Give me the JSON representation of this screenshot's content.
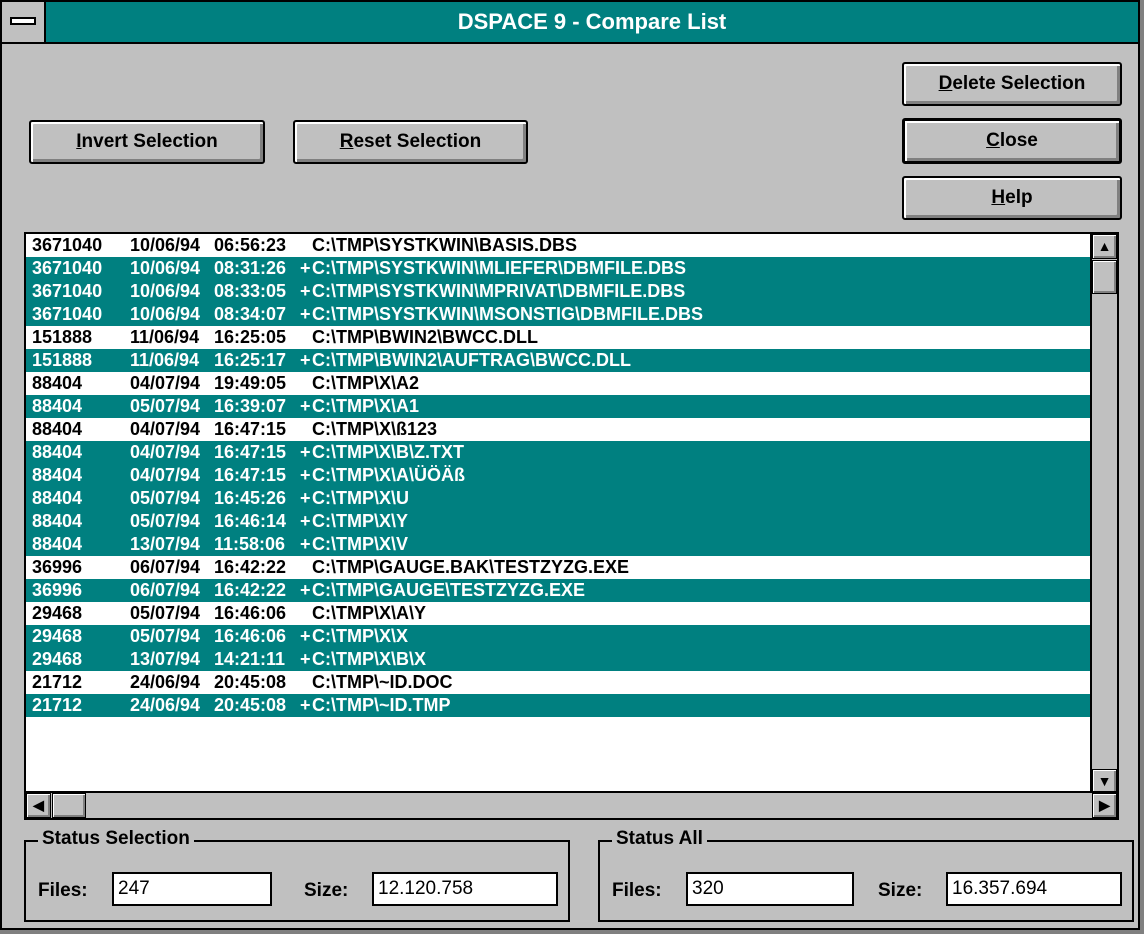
{
  "window": {
    "title": "DSPACE 9 - Compare List"
  },
  "buttons": {
    "delete_selection": {
      "pre": "",
      "key": "D",
      "post": "elete Selection"
    },
    "invert_selection": {
      "pre": "",
      "key": "I",
      "post": "nvert Selection"
    },
    "reset_selection": {
      "pre": "",
      "key": "R",
      "post": "eset Selection"
    },
    "close": {
      "pre": "",
      "key": "C",
      "post": "lose"
    },
    "help": {
      "pre": "",
      "key": "H",
      "post": "elp"
    }
  },
  "list": {
    "rows": [
      {
        "size": "3671040",
        "date": "10/06/94",
        "time": "06:56:23",
        "flag": "",
        "path": "C:\\TMP\\SYSTKWIN\\BASIS.DBS",
        "selected": false
      },
      {
        "size": "3671040",
        "date": "10/06/94",
        "time": "08:31:26",
        "flag": "+",
        "path": "C:\\TMP\\SYSTKWIN\\MLIEFER\\DBMFILE.DBS",
        "selected": true
      },
      {
        "size": "3671040",
        "date": "10/06/94",
        "time": "08:33:05",
        "flag": "+",
        "path": "C:\\TMP\\SYSTKWIN\\MPRIVAT\\DBMFILE.DBS",
        "selected": true
      },
      {
        "size": "3671040",
        "date": "10/06/94",
        "time": "08:34:07",
        "flag": "+",
        "path": "C:\\TMP\\SYSTKWIN\\MSONSTIG\\DBMFILE.DBS",
        "selected": true
      },
      {
        "size": "151888",
        "date": "11/06/94",
        "time": "16:25:05",
        "flag": "",
        "path": "C:\\TMP\\BWIN2\\BWCC.DLL",
        "selected": false
      },
      {
        "size": "151888",
        "date": "11/06/94",
        "time": "16:25:17",
        "flag": "+",
        "path": "C:\\TMP\\BWIN2\\AUFTRAG\\BWCC.DLL",
        "selected": true
      },
      {
        "size": "88404",
        "date": "04/07/94",
        "time": "19:49:05",
        "flag": "",
        "path": "C:\\TMP\\X\\A2",
        "selected": false
      },
      {
        "size": "88404",
        "date": "05/07/94",
        "time": "16:39:07",
        "flag": "+",
        "path": "C:\\TMP\\X\\A1",
        "selected": true
      },
      {
        "size": "88404",
        "date": "04/07/94",
        "time": "16:47:15",
        "flag": "",
        "path": "C:\\TMP\\X\\ß123",
        "selected": false
      },
      {
        "size": "88404",
        "date": "04/07/94",
        "time": "16:47:15",
        "flag": "+",
        "path": "C:\\TMP\\X\\B\\Z.TXT",
        "selected": true
      },
      {
        "size": "88404",
        "date": "04/07/94",
        "time": "16:47:15",
        "flag": "+",
        "path": "C:\\TMP\\X\\A\\ÜÖÄß",
        "selected": true
      },
      {
        "size": "88404",
        "date": "05/07/94",
        "time": "16:45:26",
        "flag": "+",
        "path": "C:\\TMP\\X\\U",
        "selected": true
      },
      {
        "size": "88404",
        "date": "05/07/94",
        "time": "16:46:14",
        "flag": "+",
        "path": "C:\\TMP\\X\\Y",
        "selected": true
      },
      {
        "size": "88404",
        "date": "13/07/94",
        "time": "11:58:06",
        "flag": "+",
        "path": "C:\\TMP\\X\\V",
        "selected": true
      },
      {
        "size": "36996",
        "date": "06/07/94",
        "time": "16:42:22",
        "flag": "",
        "path": "C:\\TMP\\GAUGE.BAK\\TESTZYZG.EXE",
        "selected": false
      },
      {
        "size": "36996",
        "date": "06/07/94",
        "time": "16:42:22",
        "flag": "+",
        "path": "C:\\TMP\\GAUGE\\TESTZYZG.EXE",
        "selected": true
      },
      {
        "size": "29468",
        "date": "05/07/94",
        "time": "16:46:06",
        "flag": "",
        "path": "C:\\TMP\\X\\A\\Y",
        "selected": false
      },
      {
        "size": "29468",
        "date": "05/07/94",
        "time": "16:46:06",
        "flag": "+",
        "path": "C:\\TMP\\X\\X",
        "selected": true
      },
      {
        "size": "29468",
        "date": "13/07/94",
        "time": "14:21:11",
        "flag": "+",
        "path": "C:\\TMP\\X\\B\\X",
        "selected": true
      },
      {
        "size": "21712",
        "date": "24/06/94",
        "time": "20:45:08",
        "flag": "",
        "path": "C:\\TMP\\~ID.DOC",
        "selected": false
      },
      {
        "size": "21712",
        "date": "24/06/94",
        "time": "20:45:08",
        "flag": "+",
        "path": "C:\\TMP\\~ID.TMP",
        "selected": true
      }
    ]
  },
  "status_selection": {
    "title": "Status Selection",
    "files_label": "Files:",
    "files_value": "247",
    "size_label": "Size:",
    "size_value": "12.120.758"
  },
  "status_all": {
    "title": "Status All",
    "files_label": "Files:",
    "files_value": "320",
    "size_label": "Size:",
    "size_value": "16.357.694"
  },
  "colors": {
    "selection": "#008080",
    "face": "#c0c0c0"
  },
  "icons": {
    "scroll_up": "▲",
    "scroll_down": "▼",
    "scroll_left": "◀",
    "scroll_right": "▶"
  }
}
